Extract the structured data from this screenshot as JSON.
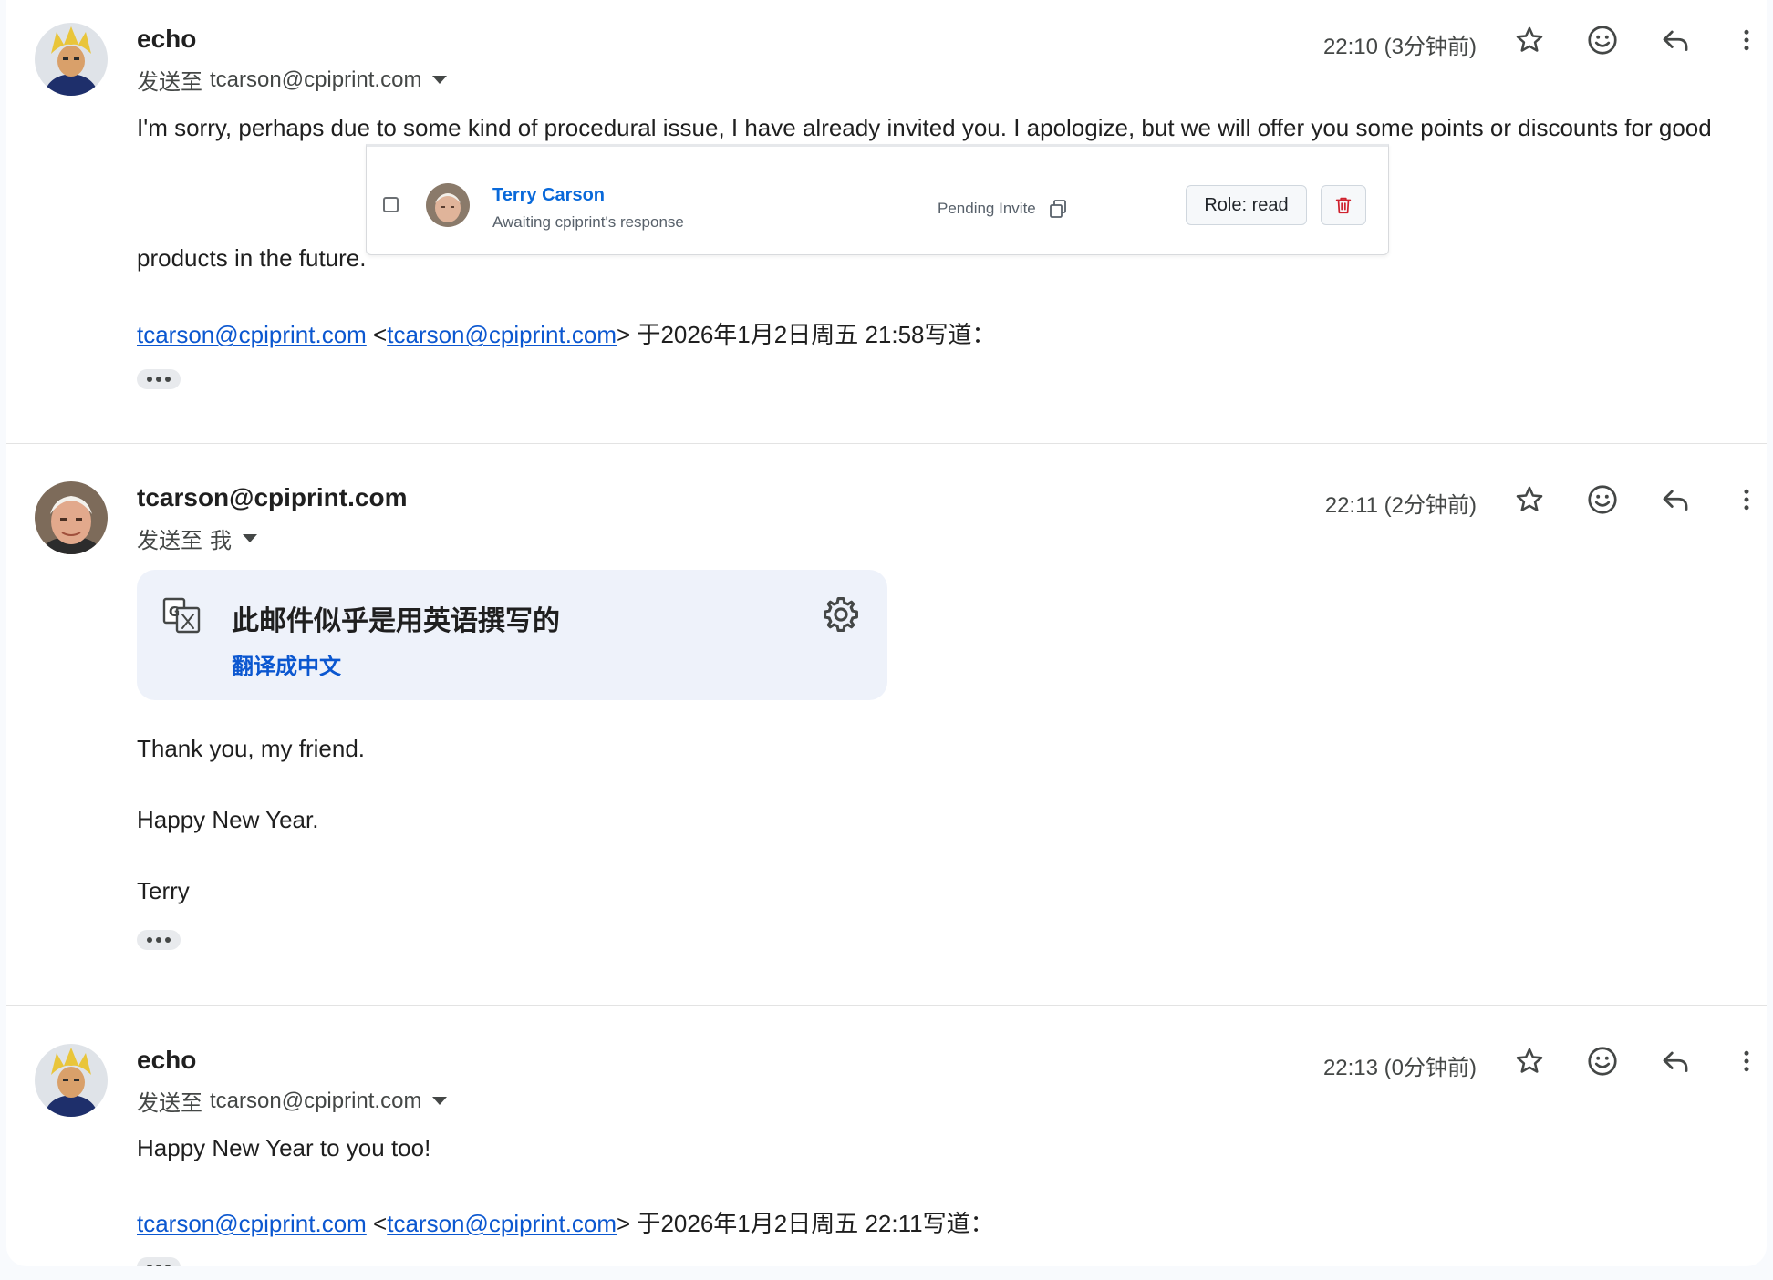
{
  "messages": [
    {
      "sender": "echo",
      "recipients_prefix": "发送至",
      "recipients": "tcarson@cpiprint.com",
      "time": "22:10 (3分钟前)",
      "body_line1": "I'm sorry, perhaps due to some kind of procedural issue, I have already invited you. I apologize, but we will offer you some points or discounts for good",
      "body_line2": "products in the future.",
      "quote_link1": "tcarson@cpiprint.com",
      "quote_open": " <",
      "quote_link2": "tcarson@cpiprint.com",
      "quote_tail": "> 于2026年1月2日周五 21:58写道："
    },
    {
      "sender": "tcarson@cpiprint.com",
      "recipients_prefix": "发送至",
      "recipients": "我",
      "time": "22:11 (2分钟前)",
      "body_lines": [
        "Thank you, my friend.",
        "Happy New Year.",
        "Terry"
      ]
    },
    {
      "sender": "echo",
      "recipients_prefix": "发送至",
      "recipients": "tcarson@cpiprint.com",
      "time": "22:13 (0分钟前)",
      "body_line1": "Happy New Year to you too!",
      "quote_link1": "tcarson@cpiprint.com",
      "quote_open": " <",
      "quote_link2": "tcarson@cpiprint.com",
      "quote_tail": "> 于2026年1月2日周五 22:11写道："
    }
  ],
  "invite": {
    "name": "Terry Carson",
    "status": "Awaiting cpiprint's response",
    "pending": "Pending Invite",
    "role": "Role: read"
  },
  "translate": {
    "title": "此邮件似乎是用英语撰写的",
    "link": "翻译成中文"
  },
  "icons": {
    "star": "star-icon",
    "emoji": "emoji-icon",
    "reply": "reply-icon",
    "more": "more-vert-icon",
    "copy": "copy-icon",
    "trash": "trash-icon",
    "translate": "translate-icon",
    "gear": "gear-icon"
  },
  "colors": {
    "link": "#0b57d0",
    "invite_name": "#0969da",
    "delete_red": "#cf222e",
    "banner_bg": "#eef2fa"
  }
}
